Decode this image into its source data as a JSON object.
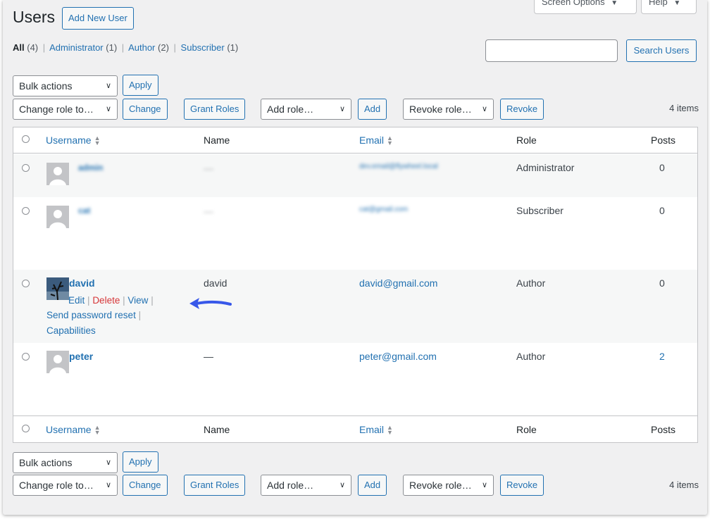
{
  "header": {
    "title": "Users",
    "add_new_label": "Add New User",
    "screen_options_label": "Screen Options",
    "help_label": "Help"
  },
  "filters": {
    "all_label": "All",
    "all_count": "(4)",
    "administrator_label": "Administrator",
    "administrator_count": "(1)",
    "author_label": "Author",
    "author_count": "(2)",
    "subscriber_label": "Subscriber",
    "subscriber_count": "(1)",
    "separator": "|"
  },
  "search": {
    "value": "",
    "button_label": "Search Users"
  },
  "toolbar": {
    "bulk_actions": "Bulk actions",
    "apply": "Apply",
    "change_role": "Change role to…",
    "change": "Change",
    "grant_roles": "Grant Roles",
    "add_role": "Add role…",
    "add": "Add",
    "revoke_role": "Revoke role…",
    "revoke": "Revoke",
    "items_count": "4 items"
  },
  "table": {
    "columns": {
      "username": "Username",
      "name": "Name",
      "email": "Email",
      "role": "Role",
      "posts": "Posts"
    },
    "rows": [
      {
        "username": "admin",
        "name": "—",
        "email": "dev.email@flywheel.local",
        "role": "Administrator",
        "posts": "0"
      },
      {
        "username": "cat",
        "name": "—",
        "email": "cat@gmail.com",
        "role": "Subscriber",
        "posts": "0"
      },
      {
        "username": "david",
        "name": "david",
        "email": "david@gmail.com",
        "role": "Author",
        "posts": "0"
      },
      {
        "username": "peter",
        "name": "—",
        "email": "peter@gmail.com",
        "role": "Author",
        "posts": "2"
      }
    ],
    "row_actions": {
      "edit": "Edit",
      "delete": "Delete",
      "view": "View",
      "send_password_reset": "Send password reset",
      "capabilities": "Capabilities",
      "sep": "|"
    }
  },
  "colors": {
    "accent": "#2271b1",
    "delete": "#d63638",
    "arrow": "#3858e9",
    "background": "#f0f0f1"
  }
}
